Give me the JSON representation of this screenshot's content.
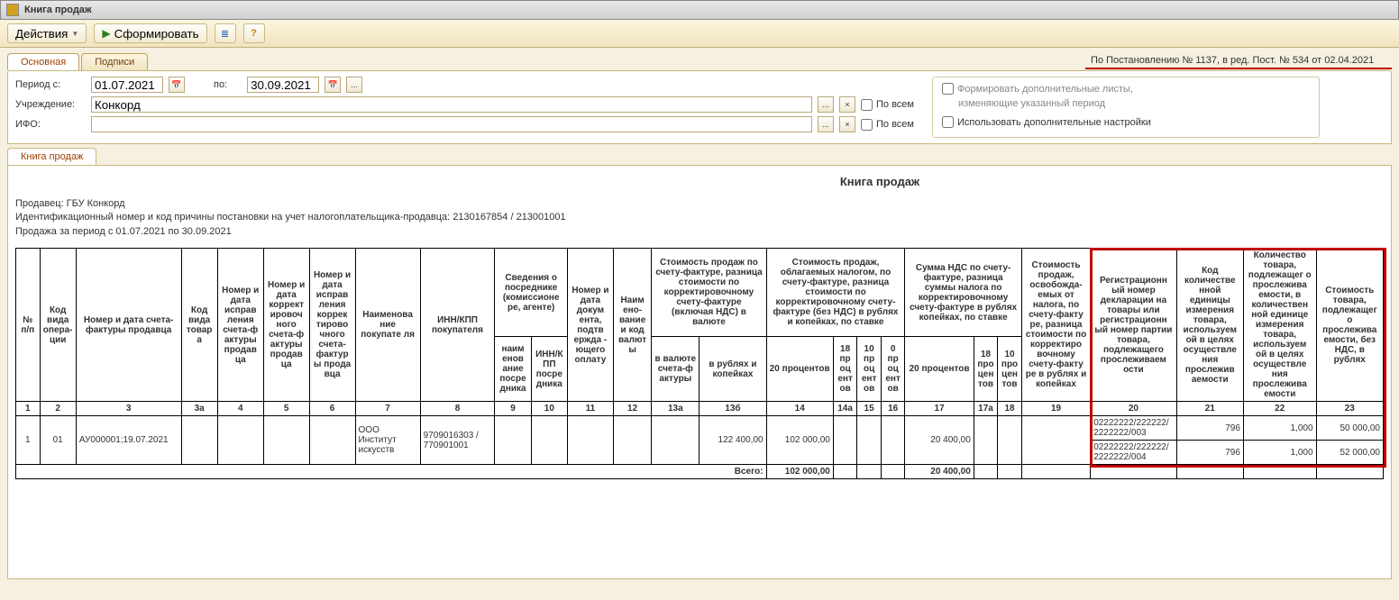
{
  "window": {
    "title": "Книга продаж"
  },
  "toolbar": {
    "actions_label": "Действия",
    "form_label": "Сформировать"
  },
  "tabs": {
    "main": "Основная",
    "signatures": "Подписи"
  },
  "regulation_text": "По Постановлению № 1137, в ред. Пост. № 534 от 02.04.2021",
  "filters": {
    "period_from_label": "Период с:",
    "period_from_value": "01.07.2021",
    "period_to_label": "по:",
    "period_to_value": "30.09.2021",
    "org_label": "Учреждение:",
    "org_value": "Конкорд",
    "ifo_label": "ИФО:",
    "ifo_value": "",
    "all_label": "По всем",
    "extra_sheets_label": "Формировать дополнительные листы,",
    "extra_sheets_sub": "изменяющие указанный период",
    "extra_settings_label": "Использовать дополнительные настройки"
  },
  "inner_tab": "Книга продаж",
  "report": {
    "title": "Книга продаж",
    "seller_line": "Продавец:  ГБУ Конкорд",
    "inn_line": "Идентификационный номер и код причины постановки на учет налогоплательщика-продавца:  2130167854 / 213001001",
    "period_line": "Продажа за период с 01.07.2021 по 30.09.2021",
    "total_label": "Всего:"
  },
  "headers": {
    "c1": "№ п/п",
    "c2": "Код вида опера-ции",
    "c3": "Номер и дата счета-фактуры продавца",
    "c3a": "Код вида товара",
    "c4": "Номер и дата исправ ления счета-ф актуры продав ца",
    "c5": "Номер и дата коррект ировоч ного счета-ф актуры продав ца",
    "c6": "Номер и дата исправ ления коррек тирово чного счета-фактур ы прода вца",
    "c7": "Наименова ние покупате ля",
    "c8": "ИНН/КПП покупателя",
    "c9g": "Сведения о посреднике (комиссионе ре, агенте)",
    "c9": "наим енов ание посре дника",
    "c10": "ИНН/К ПП посре дника",
    "c11": "Номер и дата докум ента, подтв ержда - ющего оплату",
    "c12": "Наим ено-вание и код валюты",
    "c13g": "Стоимость продаж по счету-фактуре, разница стоимости по корректировочному счету-фактуре (включая НДС) в валюте",
    "c13a": "в валюте счета-ф актуры",
    "c13b": "в рублях и копейках",
    "c14g": "Стоимость продаж, облагаемых налогом, по счету-фактуре, разница стоимости по корректировочному счету-фактуре (без НДС)  в рублях и копейках, по ставке",
    "c14": "20 процентов",
    "c14a": "18 пр оц ент ов",
    "c15": "10 пр оц ент ов",
    "c16": "0 пр оц ент ов",
    "c17g": "Сумма НДС по счету-фактуре, разница суммы налога по корректировочному счету-фактуре в рублях  копейках, по ставке",
    "c17": "20 процентов",
    "c17a": "18 про цен тов",
    "c18": "10 про цен тов",
    "c19": "Стоимость продаж, освобожда-емых от налога, по счету-факту ре, разница стоимости по корректиро вочному счету-факту ре в рублях и копейках",
    "c20": "Регистрационн ый номер декларации на товары или регистрационн ый номер партии товара, подлежащего прослеживаем ости",
    "c21": "Код количестве нной единицы измерения товара, использyем ой в целях осуществле ния прослежив аемости",
    "c22": "Количество товара, подлежащег о прослежива емости, в количествен ной единице измерения товара, используем ой в целях осуществле ния прослежива емости",
    "c23": "Стоимость товара, подлежащег о прослежива емости, без НДС, в рублях"
  },
  "colnums": [
    "1",
    "2",
    "3",
    "3а",
    "4",
    "5",
    "6",
    "7",
    "8",
    "9",
    "10",
    "11",
    "12",
    "13а",
    "13б",
    "14",
    "14а",
    "15",
    "16",
    "17",
    "17а",
    "18",
    "19",
    "20",
    "21",
    "22",
    "23"
  ],
  "rows": [
    {
      "n": "1",
      "op": "01",
      "sf": "АУ000001;19.07.2021",
      "buyer": "ООО Институт искусств",
      "inn": "9709016303 / 770901001",
      "sum13b": "122 400,00",
      "sum14": "102 000,00",
      "sum17": "20 400,00",
      "trace": [
        {
          "c20": "02222222/222222/2222222/003",
          "c21": "796",
          "c22": "1,000",
          "c23": "50 000,00"
        },
        {
          "c20": "02222222/222222/2222222/004",
          "c21": "796",
          "c22": "1,000",
          "c23": "52 000,00"
        }
      ]
    }
  ],
  "totals": {
    "sum14": "102 000,00",
    "sum17": "20 400,00"
  }
}
